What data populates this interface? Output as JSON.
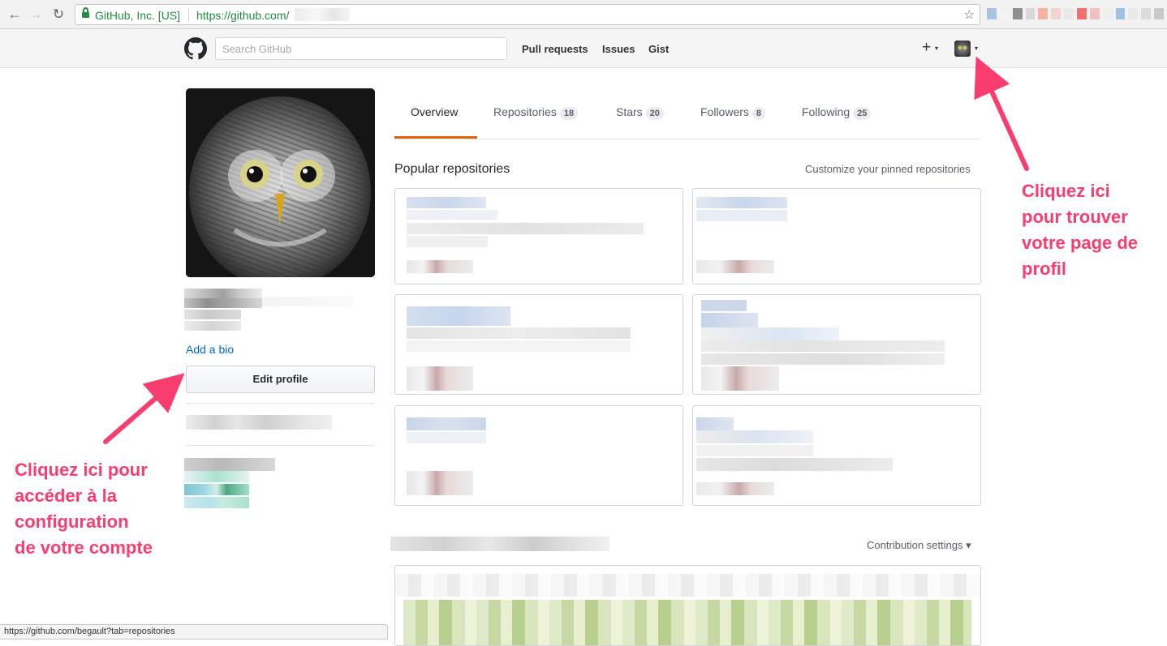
{
  "browser": {
    "site_identity": "GitHub, Inc. [US]",
    "url": "https://github.com/",
    "back_icon": "arrow-left-icon",
    "forward_icon": "arrow-right-icon",
    "reload_icon": "reload-icon",
    "bookmark_icon": "star-icon",
    "lock_icon": "lock-icon",
    "status_url": "https://github.com/begault?tab=repositories"
  },
  "header": {
    "logo_icon": "github-mark-icon",
    "search_placeholder": "Search GitHub",
    "nav": [
      "Pull requests",
      "Issues",
      "Gist"
    ],
    "new_icon": "+",
    "caret": "▾"
  },
  "profile": {
    "add_bio": "Add a bio",
    "edit_profile": "Edit profile"
  },
  "tabs": [
    {
      "label": "Overview",
      "count": null,
      "selected": true
    },
    {
      "label": "Repositories",
      "count": "18",
      "selected": false
    },
    {
      "label": "Stars",
      "count": "20",
      "selected": false
    },
    {
      "label": "Followers",
      "count": "8",
      "selected": false
    },
    {
      "label": "Following",
      "count": "25",
      "selected": false
    }
  ],
  "popular": {
    "title": "Popular repositories",
    "customize": "Customize your pinned repositories"
  },
  "contributions": {
    "settings": "Contribution settings ▾"
  },
  "annotations": {
    "right": "Cliquez ici\npour trouver\nvotre page de\nprofil",
    "left": "Cliquez ici pour\naccéder à la\nconfiguration\nde votre compte",
    "color": "#f93d6f"
  },
  "colors": {
    "accent_tab": "#e36209",
    "link": "#0366d6"
  }
}
